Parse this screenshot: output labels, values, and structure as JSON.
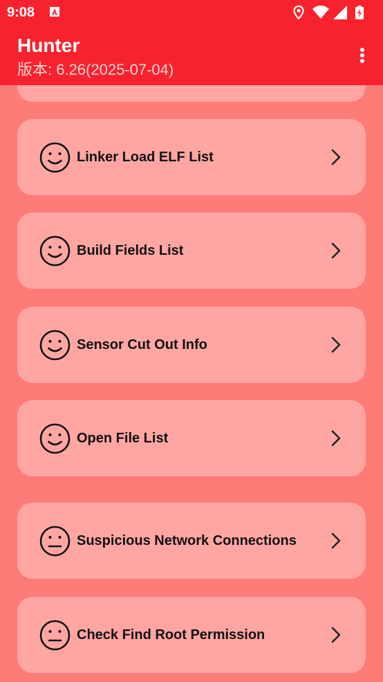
{
  "status_bar": {
    "time": "9:08",
    "icons": [
      "app-notification-icon",
      "location-icon",
      "wifi-icon",
      "signal-icon",
      "battery-charging-icon"
    ]
  },
  "app_bar": {
    "title": "Hunter",
    "subtitle": "版本: 6.26(2025-07-04)",
    "overflow_icon": "more-vert-icon"
  },
  "list": {
    "items": [
      {
        "label": "Linker Load ELF List",
        "icon": "smile-face-icon"
      },
      {
        "label": "Build Fields List",
        "icon": "smile-face-icon"
      },
      {
        "label": "Sensor Cut Out Info",
        "icon": "smile-face-icon"
      },
      {
        "label": "Open File List",
        "icon": "smile-face-icon"
      },
      {
        "label": "Suspicious Network Connections",
        "icon": "neutral-face-icon"
      },
      {
        "label": "Check Find Root Permission",
        "icon": "neutral-face-icon"
      }
    ]
  },
  "colors": {
    "status_bar": "#f8222e",
    "background": "#ff7b78",
    "card": "#ffa6a3"
  }
}
